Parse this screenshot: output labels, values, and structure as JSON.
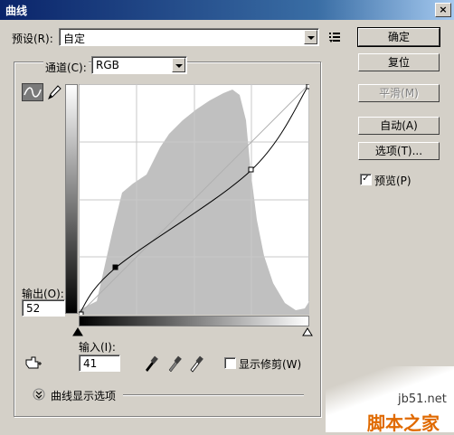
{
  "window": {
    "title": "曲线",
    "close_glyph": "×"
  },
  "preset": {
    "label": "预设(R):",
    "value": "自定"
  },
  "channel": {
    "label": "通道(C):",
    "value": "RGB"
  },
  "output": {
    "label": "输出(O):",
    "value": "52"
  },
  "input": {
    "label": "输入(I):",
    "value": "41"
  },
  "buttons": {
    "ok": "确定",
    "reset": "复位",
    "smooth": "平滑(M)",
    "auto": "自动(A)",
    "options": "选项(T)..."
  },
  "preview": {
    "label": "预览(P)",
    "checked": true
  },
  "show_clipping": {
    "label": "显示修剪(W)",
    "checked": false
  },
  "curve_display_options": "曲线显示选项",
  "watermark": {
    "url": "jb51.net",
    "text": "脚本之家"
  },
  "curve": {
    "points": [
      [
        0,
        0
      ],
      [
        41,
        52
      ],
      [
        191,
        160
      ],
      [
        255,
        255
      ]
    ]
  }
}
